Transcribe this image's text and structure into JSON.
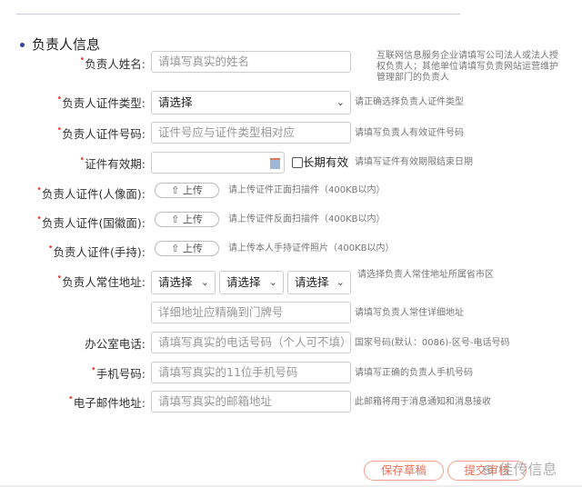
{
  "section_title": "负责人信息",
  "fields": {
    "name": {
      "label": "负责人姓名:",
      "placeholder": "请填写真实的姓名",
      "hint": "互联网信息服务企业请填写公司法人或法人授权负责人；其他单位请填写负责网站运营维护管理部门的负责人"
    },
    "id_type": {
      "label": "负责人证件类型:",
      "value": "请选择",
      "hint": "请正确选择负责人证件类型"
    },
    "id_number": {
      "label": "负责人证件号码:",
      "placeholder": "证件号应与证件类型相对应",
      "hint": "请填写负责人有效证件号码"
    },
    "validity": {
      "label": "证件有效期:",
      "checkbox": "长期有效",
      "hint": "请填写证件有效期限结束日期"
    },
    "id_front": {
      "label": "负责人证件(人像面):",
      "button": "上传",
      "hint": "请上传证件正面扫描件（400KB以内）"
    },
    "id_back": {
      "label": "负责人证件(国徽面):",
      "button": "上传",
      "hint": "请上传证件反面扫描件（400KB以内）"
    },
    "id_hand": {
      "label": "负责人证件(手持):",
      "button": "上传",
      "hint": "请上传本人手持证件照片（400KB以内）"
    },
    "address": {
      "label": "负责人常住地址:",
      "province": "请选择",
      "city": "请选择",
      "district": "请选择",
      "hint": "请选择负责人常住地址所属省市区",
      "detail_placeholder": "详细地址应精确到门牌号",
      "detail_hint": "请填写负责人常住详细地址"
    },
    "office_phone": {
      "label": "办公室电话:",
      "placeholder": "请填写真实的电话号码（个人可不填）",
      "hint": "国家号码(默认：0086)-区号-电话号码"
    },
    "mobile": {
      "label": "手机号码:",
      "placeholder": "请填写真实的11位手机号码",
      "hint": "请填写正确的负责人手机号码"
    },
    "email": {
      "label": "电子邮件地址:",
      "placeholder": "请填写真实的邮箱地址",
      "hint": "此邮箱将用于消息通知和消息接收"
    }
  },
  "buttons": {
    "save": "保存草稿",
    "submit": "提交审核"
  },
  "watermark": "佳传信息"
}
